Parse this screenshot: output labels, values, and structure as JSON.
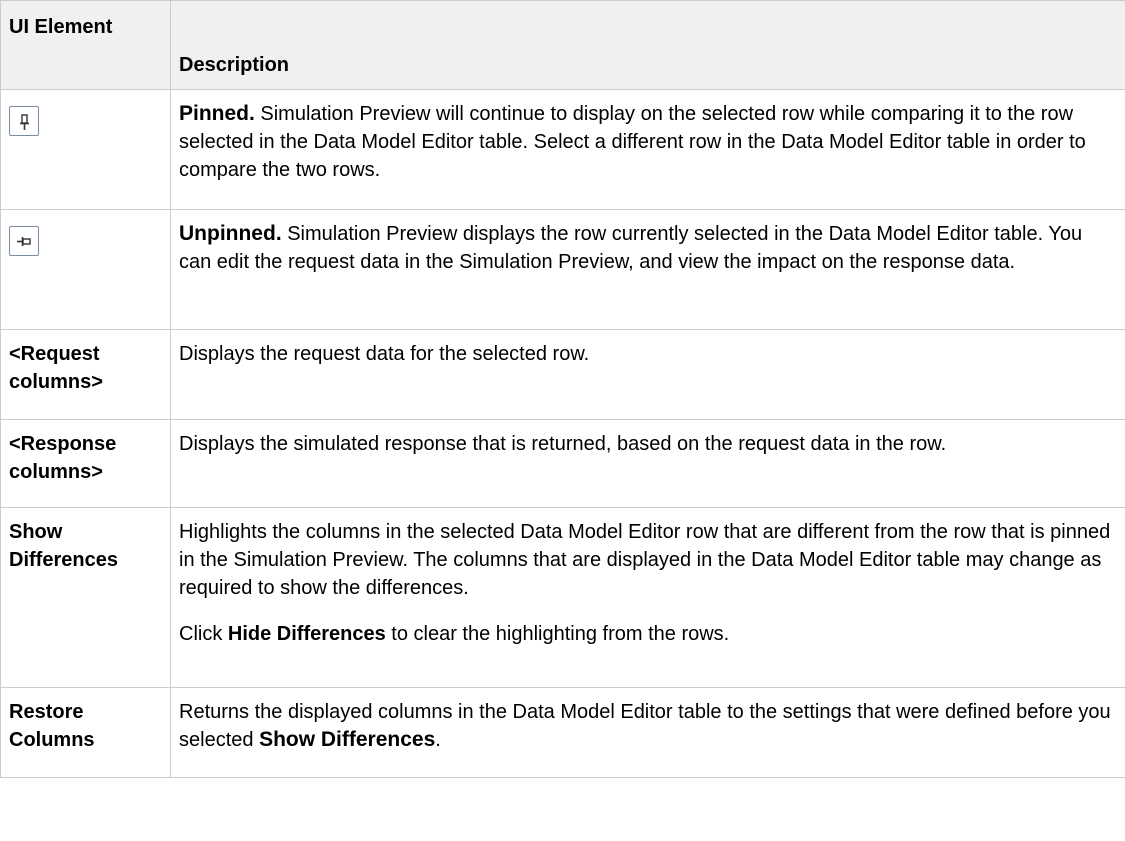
{
  "header": {
    "col1": "UI Element",
    "col2": "Description"
  },
  "rows": [
    {
      "icon": "pin-pinned-icon",
      "desc_bold": "Pinned.",
      "desc": " Simulation Preview will continue to display on the selected row while comparing it to the row selected in the Data Model Editor table. Select a different row in the Data Model Editor table in order to compare the two rows."
    },
    {
      "icon": "pin-unpinned-icon",
      "desc_bold": "Unpinned.",
      "desc": " Simulation Preview displays the row currently selected in the Data Model Editor table. You can edit the request data in the Simulation Preview, and view the impact on the response data."
    },
    {
      "element": "<Request columns>",
      "desc": "Displays the request data for the selected row."
    },
    {
      "element": "<Response columns>",
      "desc": "Displays the simulated response that is returned, based on the request data in the row."
    },
    {
      "element": "Show Differences",
      "desc": "Highlights the columns in the selected Data Model Editor row that are different from the row that is pinned in the Simulation Preview. The columns that are displayed in the Data Model Editor table may change as required to show the differences.",
      "desc2_pre": "Click ",
      "desc2_bold": "Hide Differences",
      "desc2_post": " to clear the highlighting from the rows."
    },
    {
      "element": "Restore Columns",
      "desc_pre": "Returns the displayed columns in the Data Model Editor table to the settings that were defined before you selected ",
      "desc_bold": "Show Differences",
      "desc_post": "."
    }
  ]
}
